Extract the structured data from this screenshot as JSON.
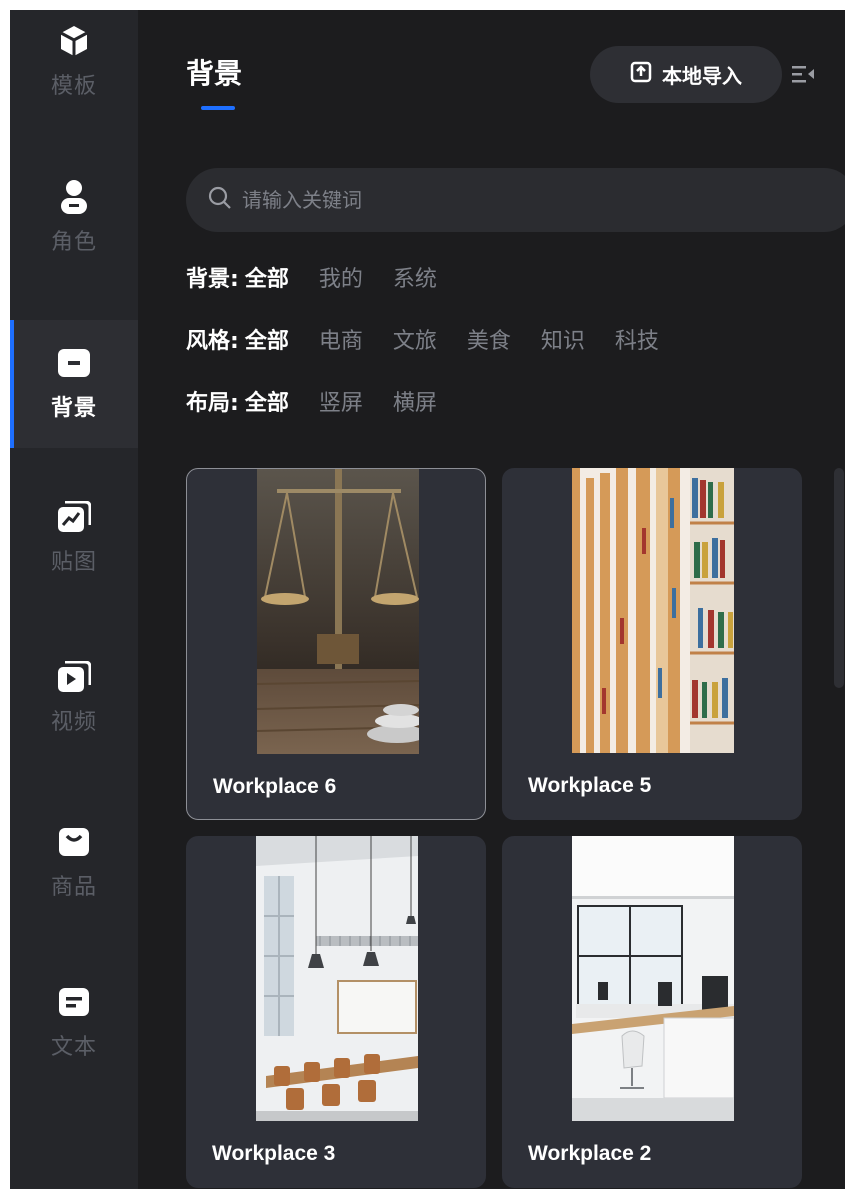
{
  "sidebar": {
    "items": [
      {
        "label": "模板",
        "icon": "cube-icon"
      },
      {
        "label": "角色",
        "icon": "person-icon"
      },
      {
        "label": "背景",
        "icon": "background-icon",
        "active": true
      },
      {
        "label": "贴图",
        "icon": "sticker-icon"
      },
      {
        "label": "视频",
        "icon": "video-icon"
      },
      {
        "label": "商品",
        "icon": "shopping-bag-icon"
      },
      {
        "label": "文本",
        "icon": "text-icon"
      }
    ]
  },
  "header": {
    "title": "背景",
    "import_label": "本地导入"
  },
  "search": {
    "placeholder": "请输入关键词"
  },
  "filters": [
    {
      "label": "背景:",
      "options": [
        "全部",
        "我的",
        "系统"
      ],
      "selected": "全部"
    },
    {
      "label": "风格:",
      "options": [
        "全部",
        "电商",
        "文旅",
        "美食",
        "知识",
        "科技"
      ],
      "selected": "全部"
    },
    {
      "label": "布局:",
      "options": [
        "全部",
        "竖屏",
        "横屏"
      ],
      "selected": "全部"
    }
  ],
  "backgrounds": [
    {
      "name": "Workplace 6",
      "selected": true
    },
    {
      "name": "Workplace 5"
    },
    {
      "name": "Workplace 3"
    },
    {
      "name": "Workplace 2"
    }
  ],
  "colors": {
    "accent": "#1e6fff",
    "panel": "#1c1c1e",
    "sidebar": "#25262a",
    "card": "#2e3038"
  }
}
